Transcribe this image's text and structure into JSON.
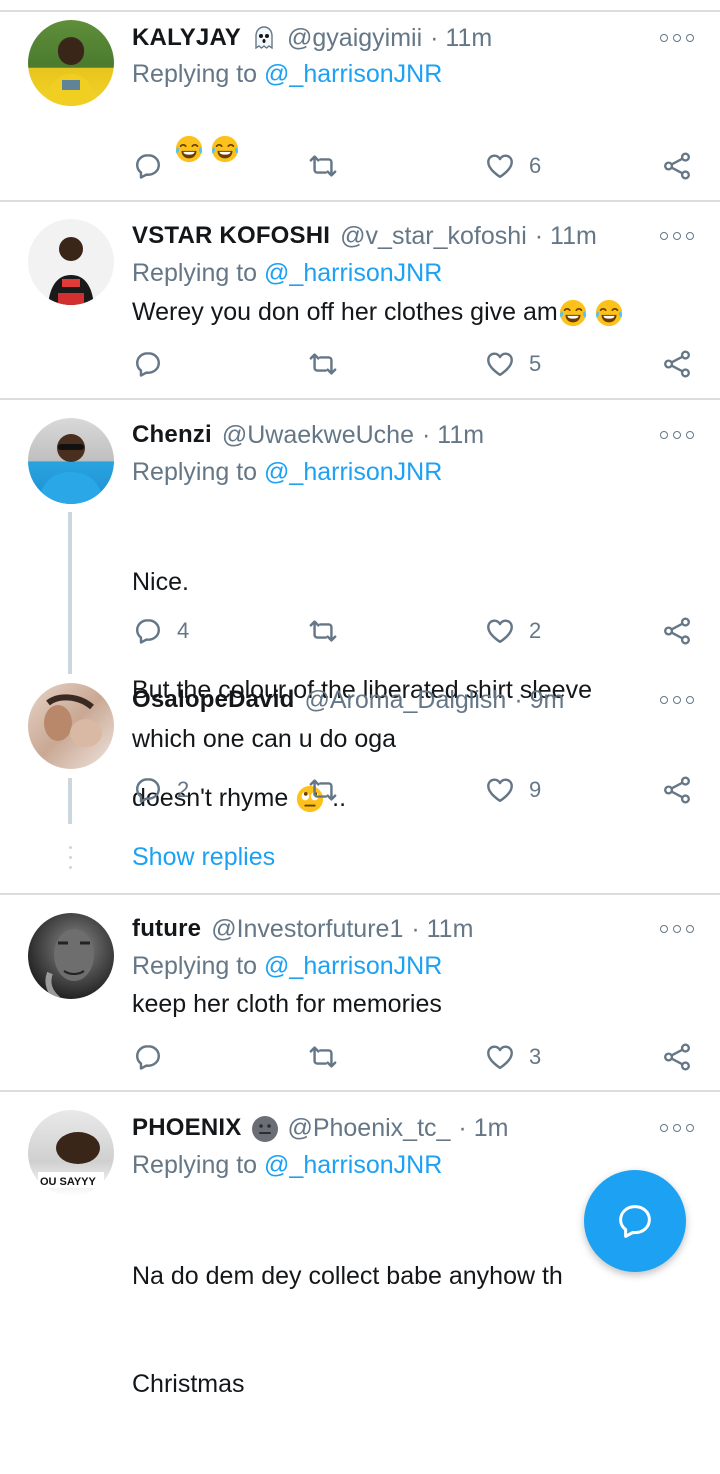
{
  "tweets": [
    {
      "name": "KALYJAY",
      "badge": "ghost-emoji",
      "handle": "@gyaigyimii",
      "time": "· 11m",
      "replying_prefix": "Replying to ",
      "replying_to": "@_harrisonJNR",
      "text": "",
      "emojis": [
        "joy-emoji",
        "joy-emoji"
      ],
      "reply_count": "",
      "like_count": "6"
    },
    {
      "name": "VSTAR KOFOSHI",
      "handle": "@v_star_kofoshi",
      "time": "· 11m",
      "replying_prefix": "Replying to ",
      "replying_to": "@_harrisonJNR",
      "text": "Werey you don off her clothes give am",
      "emojis": [
        "joy-emoji",
        "joy-emoji"
      ],
      "reply_count": "",
      "like_count": "5"
    },
    {
      "name": "Chenzi",
      "handle": "@UwaekweUche",
      "time": "· 11m",
      "replying_prefix": "Replying to ",
      "replying_to": "@_harrisonJNR",
      "text_line1": "Nice.",
      "text_line2": "But the colour of the liberated shirt sleeve",
      "text_line3": "doesn't rhyme",
      "text_suffix": " ..",
      "emojis": [
        "rolling-eyes-emoji"
      ],
      "reply_count": "4",
      "like_count": "2"
    },
    {
      "name": "OsalopeDavid",
      "handle": "@Aroma_Dalglish",
      "time": "· 9m",
      "text": "which one can u do oga",
      "reply_count": "2",
      "like_count": "9"
    },
    {
      "name": "future",
      "handle": "@Investorfuture1",
      "time": "· 11m",
      "replying_prefix": "Replying to ",
      "replying_to": "@_harrisonJNR",
      "text": "keep her cloth for memories",
      "reply_count": "",
      "like_count": "3"
    },
    {
      "name": "PHOENIX",
      "badge": "neutral-face-emoji",
      "handle": "@Phoenix_tc_",
      "time": "· 1m",
      "replying_prefix": "Replying to ",
      "replying_to": "@_harrisonJNR",
      "text_line1": "Na do dem dey collect babe anyhow  th",
      "text_line2": "Christmas"
    }
  ],
  "show_replies": "Show replies",
  "avatar_text_phoenix": "OU SAYYY",
  "colors": {
    "accent": "#1da1f2",
    "secondary_text": "#657786",
    "divider": "#dadde0",
    "thread_line": "#ccd6dd"
  },
  "icons": {
    "reply": "reply-icon",
    "retweet": "retweet-icon",
    "like": "heart-icon",
    "share": "share-icon",
    "more": "more-options-icon",
    "fab": "compose-reply-icon"
  }
}
